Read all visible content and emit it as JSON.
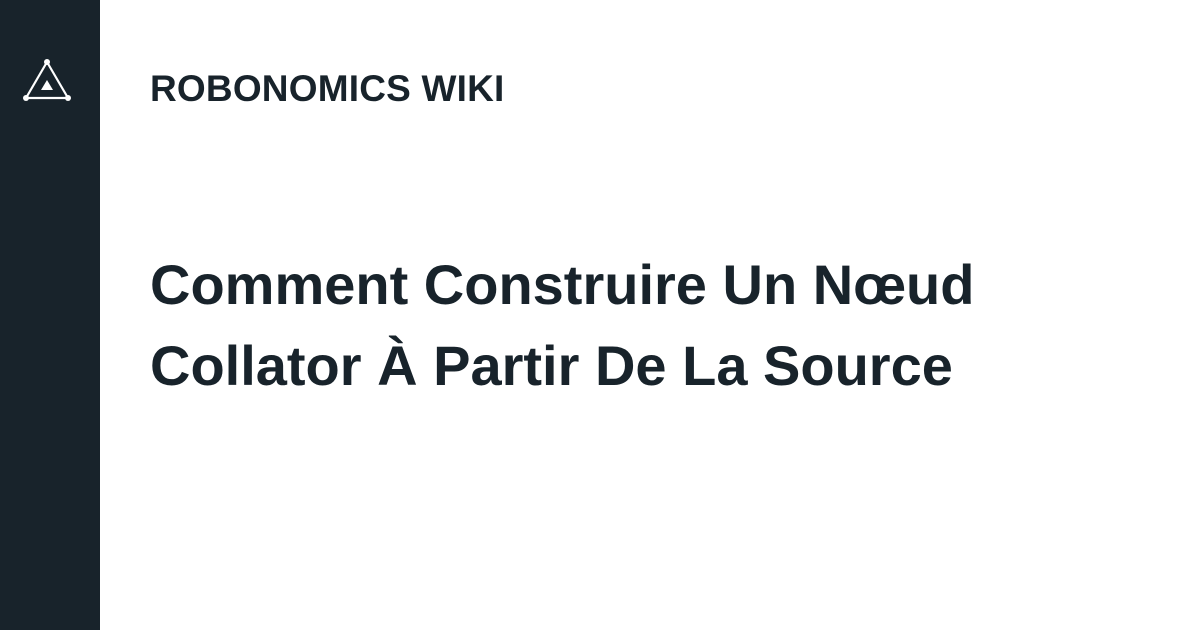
{
  "brand": {
    "logo_icon": "triangle-network-logo-icon",
    "site_name": "ROBONOMICS WIKI"
  },
  "article": {
    "title_lines": [
      "Comment Construire Un Nœud",
      "Collator À Partir De La Source"
    ]
  },
  "colors": {
    "sidebar": "#18232b",
    "background": "#ffffff",
    "text": "#18232b",
    "logo": "#ffffff"
  }
}
